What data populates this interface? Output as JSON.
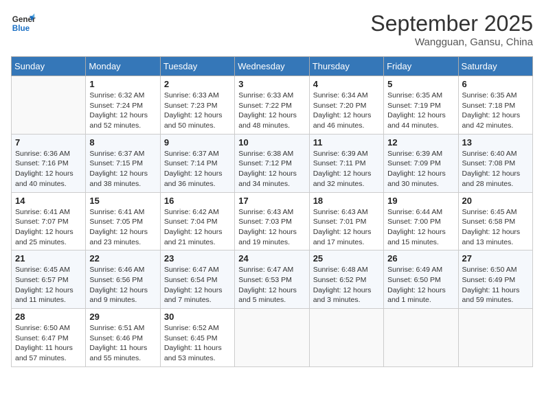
{
  "header": {
    "logo_line1": "General",
    "logo_line2": "Blue",
    "month_year": "September 2025",
    "location": "Wangguan, Gansu, China"
  },
  "weekdays": [
    "Sunday",
    "Monday",
    "Tuesday",
    "Wednesday",
    "Thursday",
    "Friday",
    "Saturday"
  ],
  "weeks": [
    [
      {
        "day": "",
        "info": ""
      },
      {
        "day": "1",
        "info": "Sunrise: 6:32 AM\nSunset: 7:24 PM\nDaylight: 12 hours\nand 52 minutes."
      },
      {
        "day": "2",
        "info": "Sunrise: 6:33 AM\nSunset: 7:23 PM\nDaylight: 12 hours\nand 50 minutes."
      },
      {
        "day": "3",
        "info": "Sunrise: 6:33 AM\nSunset: 7:22 PM\nDaylight: 12 hours\nand 48 minutes."
      },
      {
        "day": "4",
        "info": "Sunrise: 6:34 AM\nSunset: 7:20 PM\nDaylight: 12 hours\nand 46 minutes."
      },
      {
        "day": "5",
        "info": "Sunrise: 6:35 AM\nSunset: 7:19 PM\nDaylight: 12 hours\nand 44 minutes."
      },
      {
        "day": "6",
        "info": "Sunrise: 6:35 AM\nSunset: 7:18 PM\nDaylight: 12 hours\nand 42 minutes."
      }
    ],
    [
      {
        "day": "7",
        "info": "Sunrise: 6:36 AM\nSunset: 7:16 PM\nDaylight: 12 hours\nand 40 minutes."
      },
      {
        "day": "8",
        "info": "Sunrise: 6:37 AM\nSunset: 7:15 PM\nDaylight: 12 hours\nand 38 minutes."
      },
      {
        "day": "9",
        "info": "Sunrise: 6:37 AM\nSunset: 7:14 PM\nDaylight: 12 hours\nand 36 minutes."
      },
      {
        "day": "10",
        "info": "Sunrise: 6:38 AM\nSunset: 7:12 PM\nDaylight: 12 hours\nand 34 minutes."
      },
      {
        "day": "11",
        "info": "Sunrise: 6:39 AM\nSunset: 7:11 PM\nDaylight: 12 hours\nand 32 minutes."
      },
      {
        "day": "12",
        "info": "Sunrise: 6:39 AM\nSunset: 7:09 PM\nDaylight: 12 hours\nand 30 minutes."
      },
      {
        "day": "13",
        "info": "Sunrise: 6:40 AM\nSunset: 7:08 PM\nDaylight: 12 hours\nand 28 minutes."
      }
    ],
    [
      {
        "day": "14",
        "info": "Sunrise: 6:41 AM\nSunset: 7:07 PM\nDaylight: 12 hours\nand 25 minutes."
      },
      {
        "day": "15",
        "info": "Sunrise: 6:41 AM\nSunset: 7:05 PM\nDaylight: 12 hours\nand 23 minutes."
      },
      {
        "day": "16",
        "info": "Sunrise: 6:42 AM\nSunset: 7:04 PM\nDaylight: 12 hours\nand 21 minutes."
      },
      {
        "day": "17",
        "info": "Sunrise: 6:43 AM\nSunset: 7:03 PM\nDaylight: 12 hours\nand 19 minutes."
      },
      {
        "day": "18",
        "info": "Sunrise: 6:43 AM\nSunset: 7:01 PM\nDaylight: 12 hours\nand 17 minutes."
      },
      {
        "day": "19",
        "info": "Sunrise: 6:44 AM\nSunset: 7:00 PM\nDaylight: 12 hours\nand 15 minutes."
      },
      {
        "day": "20",
        "info": "Sunrise: 6:45 AM\nSunset: 6:58 PM\nDaylight: 12 hours\nand 13 minutes."
      }
    ],
    [
      {
        "day": "21",
        "info": "Sunrise: 6:45 AM\nSunset: 6:57 PM\nDaylight: 12 hours\nand 11 minutes."
      },
      {
        "day": "22",
        "info": "Sunrise: 6:46 AM\nSunset: 6:56 PM\nDaylight: 12 hours\nand 9 minutes."
      },
      {
        "day": "23",
        "info": "Sunrise: 6:47 AM\nSunset: 6:54 PM\nDaylight: 12 hours\nand 7 minutes."
      },
      {
        "day": "24",
        "info": "Sunrise: 6:47 AM\nSunset: 6:53 PM\nDaylight: 12 hours\nand 5 minutes."
      },
      {
        "day": "25",
        "info": "Sunrise: 6:48 AM\nSunset: 6:52 PM\nDaylight: 12 hours\nand 3 minutes."
      },
      {
        "day": "26",
        "info": "Sunrise: 6:49 AM\nSunset: 6:50 PM\nDaylight: 12 hours\nand 1 minute."
      },
      {
        "day": "27",
        "info": "Sunrise: 6:50 AM\nSunset: 6:49 PM\nDaylight: 11 hours\nand 59 minutes."
      }
    ],
    [
      {
        "day": "28",
        "info": "Sunrise: 6:50 AM\nSunset: 6:47 PM\nDaylight: 11 hours\nand 57 minutes."
      },
      {
        "day": "29",
        "info": "Sunrise: 6:51 AM\nSunset: 6:46 PM\nDaylight: 11 hours\nand 55 minutes."
      },
      {
        "day": "30",
        "info": "Sunrise: 6:52 AM\nSunset: 6:45 PM\nDaylight: 11 hours\nand 53 minutes."
      },
      {
        "day": "",
        "info": ""
      },
      {
        "day": "",
        "info": ""
      },
      {
        "day": "",
        "info": ""
      },
      {
        "day": "",
        "info": ""
      }
    ]
  ]
}
